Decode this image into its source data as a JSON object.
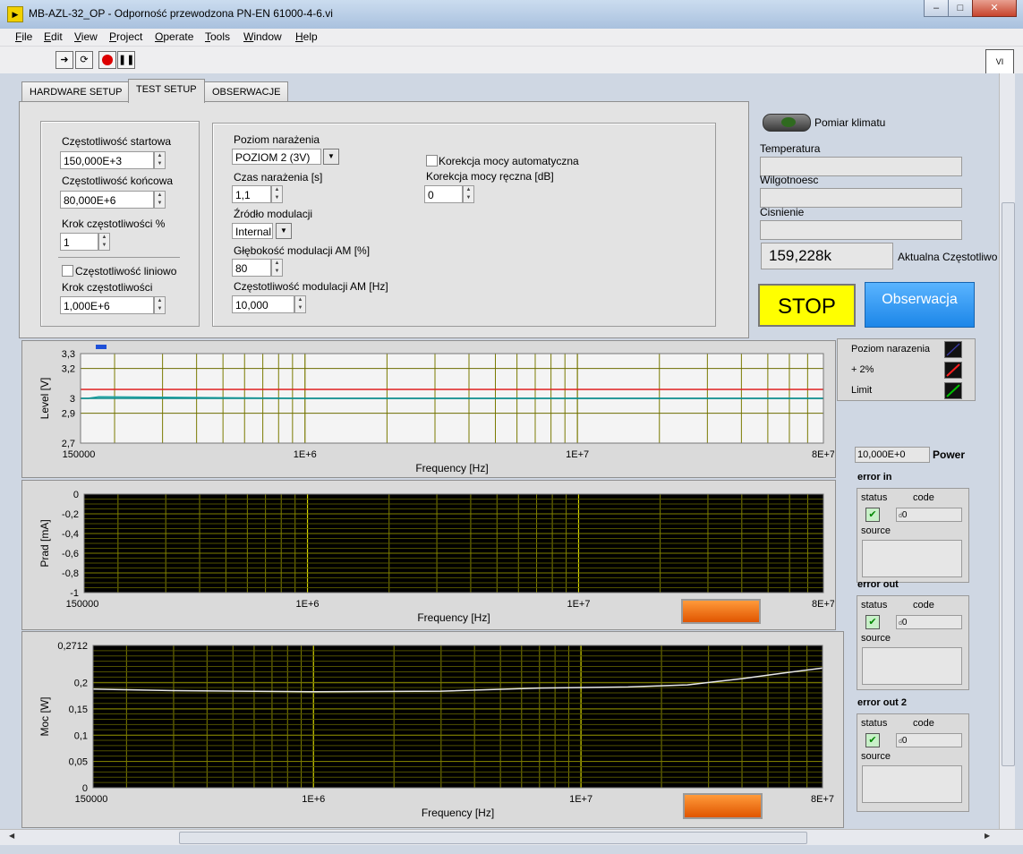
{
  "window": {
    "title": "MB-AZL-32_OP - Odporność przewodzona PN-EN 61000-4-6.vi",
    "min": "–",
    "max": "□",
    "close": "✕"
  },
  "menu": [
    "File",
    "Edit",
    "View",
    "Project",
    "Operate",
    "Tools",
    "Window",
    "Help"
  ],
  "tabs": [
    "HARDWARE SETUP",
    "TEST SETUP",
    "OBSERWACJE"
  ],
  "freq": {
    "start_label": "Częstotliwość startowa",
    "start_value": "150,000E+3",
    "end_label": "Częstotliwość końcowa",
    "end_value": "80,000E+6",
    "step_pct_label": "Krok częstotliwości %",
    "step_pct_value": "1",
    "linear_label": "Częstotliwość liniowo",
    "step_label": "Krok częstotliwości",
    "step_value": "1,000E+6"
  },
  "exposure": {
    "level_label": "Poziom narażenia",
    "level_value": "POZIOM 2 (3V)",
    "time_label": "Czas narażenia [s]",
    "time_value": "1,1",
    "mod_src_label": "Źródło modulacji",
    "mod_src_value": "Internal",
    "am_depth_label": "Głębokość modulacji AM [%]",
    "am_depth_value": "80",
    "am_freq_label": "Częstotliwość modulacji AM [Hz]",
    "am_freq_value": "10,000",
    "auto_corr_label": "Korekcja mocy automatyczna",
    "manual_corr_label": "Korekcja mocy ręczna [dB]",
    "manual_corr_value": "0"
  },
  "climate": {
    "led_label": "Pomiar klimatu",
    "temp_label": "Temperatura",
    "hum_label": "Wilgotnoesc",
    "press_label": "Cisnienie",
    "freq_value": "159,228k",
    "freq_label": "Aktualna Częstotliwo"
  },
  "buttons": {
    "stop": "STOP",
    "observe": "Obserwacja"
  },
  "legend": [
    {
      "label": "Poziom narazenia",
      "color": "#1a1a7a"
    },
    {
      "label": "+  2%",
      "color": "#ff2020"
    },
    {
      "label": "Limit",
      "color": "#00a000"
    }
  ],
  "power": {
    "value": "10,000E+0",
    "label": "Power"
  },
  "errors": [
    {
      "title": "error in",
      "status_label": "status",
      "code_label": "code",
      "code_value": "0",
      "source_label": "source",
      "code_prefix": "d"
    },
    {
      "title": "error out",
      "status_label": "status",
      "code_label": "code",
      "code_value": "0",
      "source_label": "source",
      "code_prefix": "d"
    },
    {
      "title": "error out 2",
      "status_label": "status",
      "code_label": "code",
      "code_value": "0",
      "source_label": "source",
      "code_prefix": "d"
    }
  ],
  "chart_data": [
    {
      "type": "line",
      "xlabel": "Frequency [Hz]",
      "ylabel": "Level [V]",
      "x_scale": "log",
      "xlim": [
        150000,
        80000000
      ],
      "ylim": [
        2.7,
        3.3
      ],
      "x_ticks": [
        "150000",
        "1E+6",
        "1E+7",
        "8E+7"
      ],
      "y_ticks": [
        "3,3",
        "3,2",
        "3",
        "2,9",
        "2,7"
      ],
      "y_tick_values": [
        3.3,
        3.2,
        3.0,
        2.9,
        2.7
      ],
      "series": [
        {
          "name": "Poziom narazenia",
          "x": [
            150000,
            160000,
            175000,
            1000000,
            1200000,
            2000000,
            80000000
          ],
          "y": [
            3.0,
            3.0,
            3.01,
            3.0,
            3.0,
            3.0,
            3.0
          ]
        },
        {
          "name": "+  2%",
          "x": [
            150000,
            80000000
          ],
          "y": [
            3.06,
            3.06
          ]
        },
        {
          "name": "Limit",
          "x": [
            150000,
            80000000
          ],
          "y": [
            3.0,
            3.0
          ]
        }
      ],
      "grid": true
    },
    {
      "type": "line",
      "xlabel": "Frequency [Hz]",
      "ylabel": "Prad  [mA]",
      "x_scale": "log",
      "xlim": [
        150000,
        80000000
      ],
      "ylim": [
        -1,
        0
      ],
      "x_ticks": [
        "150000",
        "1E+6",
        "1E+7",
        "8E+7"
      ],
      "y_ticks": [
        "0",
        "-0,2",
        "-0,4",
        "-0,6",
        "-0,8",
        "-1"
      ],
      "y_tick_values": [
        0,
        -0.2,
        -0.4,
        -0.6,
        -0.8,
        -1
      ],
      "series": [],
      "grid": true
    },
    {
      "type": "line",
      "xlabel": "Frequency [Hz]",
      "ylabel": "Moc  [W]",
      "x_scale": "log",
      "xlim": [
        150000,
        80000000
      ],
      "ylim": [
        0,
        0.2712
      ],
      "x_ticks": [
        "150000",
        "1E+6",
        "1E+7",
        "8E+7"
      ],
      "y_ticks": [
        "0,2712",
        "0,2",
        "0,15",
        "0,1",
        "0,05",
        "0"
      ],
      "y_tick_values": [
        0.2712,
        0.2,
        0.15,
        0.1,
        0.05,
        0
      ],
      "series": [
        {
          "name": "",
          "x": [
            150000,
            300000,
            1000000,
            3000000,
            7000000,
            15000000,
            25000000,
            40000000,
            60000000,
            80000000
          ],
          "y": [
            0.188,
            0.185,
            0.183,
            0.184,
            0.19,
            0.192,
            0.196,
            0.208,
            0.22,
            0.228
          ]
        }
      ],
      "grid": true
    }
  ]
}
